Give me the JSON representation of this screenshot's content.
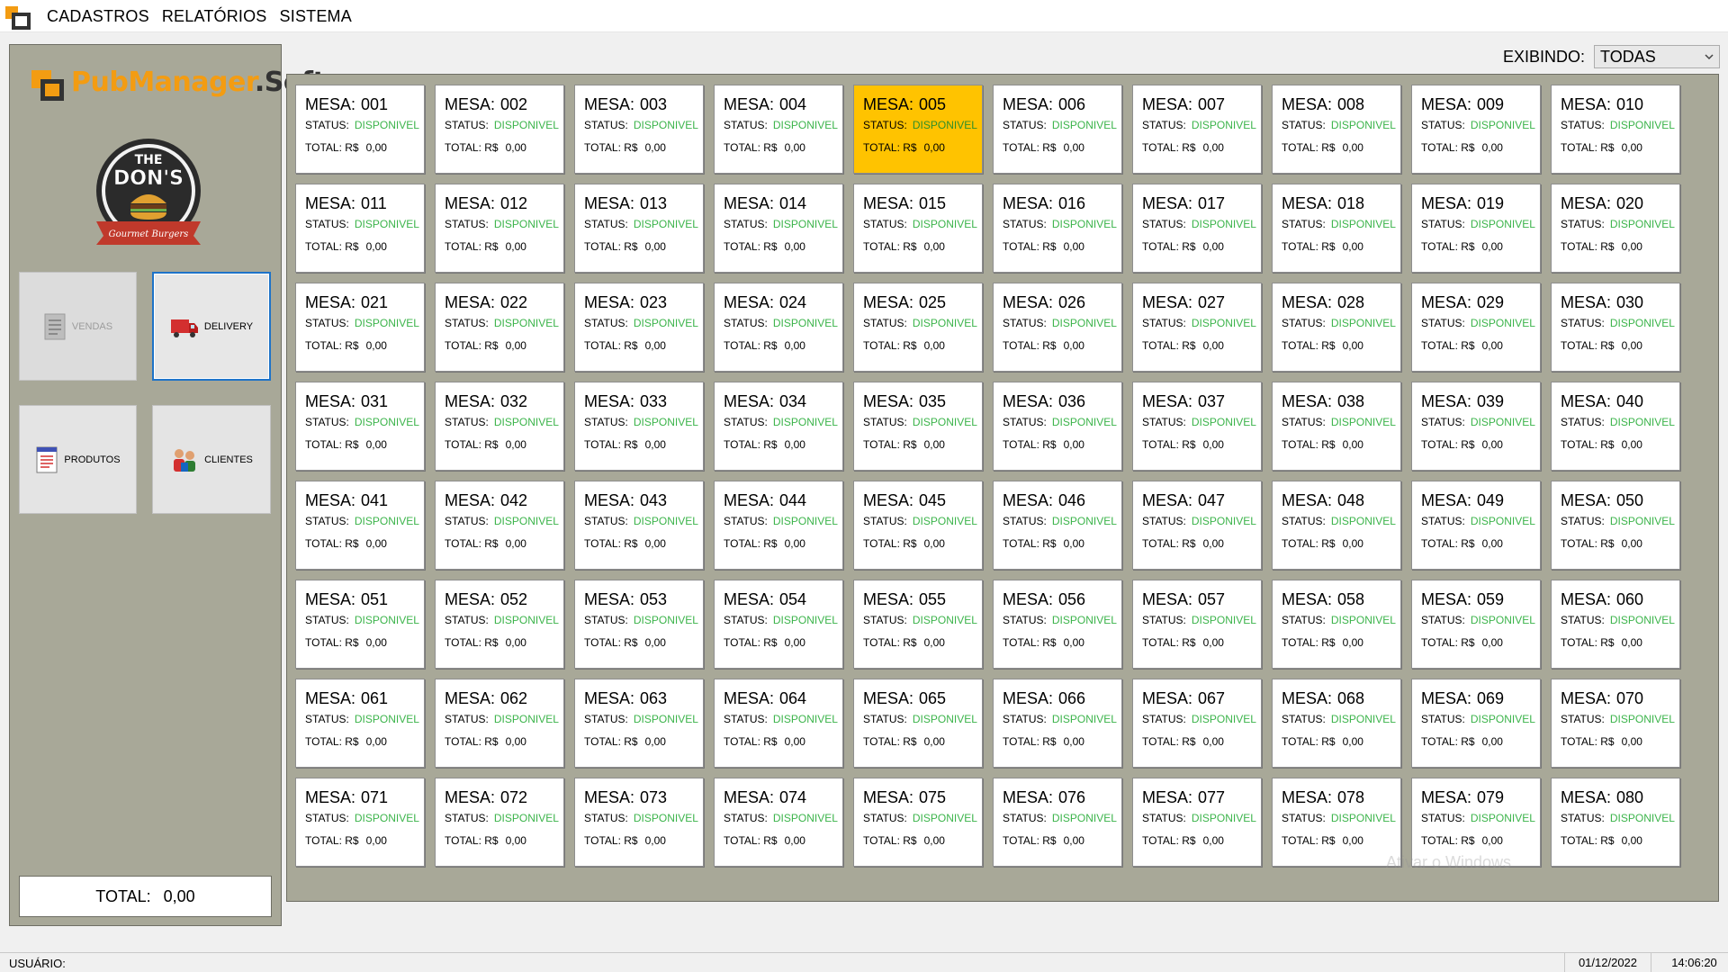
{
  "menu": {
    "items": [
      "CADASTROS",
      "RELATÓRIOS",
      "SISTEMA"
    ]
  },
  "brand": {
    "name_part1": "PubManager",
    "name_part2": ".Soft",
    "restaurant_logo_text": [
      "THE",
      "DON'S",
      "Gourmet Burgers"
    ]
  },
  "sidebar": {
    "buttons": [
      {
        "label": "VENDAS",
        "icon": "document-icon",
        "enabled": false
      },
      {
        "label": "DELIVERY",
        "icon": "delivery-truck-icon",
        "enabled": true,
        "selected": true
      },
      {
        "label": "PRODUTOS",
        "icon": "product-list-icon",
        "enabled": true
      },
      {
        "label": "CLIENTES",
        "icon": "customers-icon",
        "enabled": true
      }
    ],
    "total_label": "TOTAL:",
    "total_value": "0,00"
  },
  "filter": {
    "label": "EXIBINDO:",
    "selected": "TODAS"
  },
  "tables": {
    "title_label": "MESA:",
    "status_label": "STATUS:",
    "total_label": "TOTAL: R$",
    "status_value": "DISPONIVEL",
    "total_value": "0,00",
    "selected_number": "005",
    "numbers": [
      "001",
      "002",
      "003",
      "004",
      "005",
      "006",
      "007",
      "008",
      "009",
      "010",
      "011",
      "012",
      "013",
      "014",
      "015",
      "016",
      "017",
      "018",
      "019",
      "020",
      "021",
      "022",
      "023",
      "024",
      "025",
      "026",
      "027",
      "028",
      "029",
      "030",
      "031",
      "032",
      "033",
      "034",
      "035",
      "036",
      "037",
      "038",
      "039",
      "040",
      "041",
      "042",
      "043",
      "044",
      "045",
      "046",
      "047",
      "048",
      "049",
      "050",
      "051",
      "052",
      "053",
      "054",
      "055",
      "056",
      "057",
      "058",
      "059",
      "060",
      "061",
      "062",
      "063",
      "064",
      "065",
      "066",
      "067",
      "068",
      "069",
      "070",
      "071",
      "072",
      "073",
      "074",
      "075",
      "076",
      "077",
      "078",
      "079",
      "080"
    ]
  },
  "watermark": "Ativar o Windows",
  "statusbar": {
    "user_label": "USUÁRIO:",
    "date": "01/12/2022",
    "time": "14:06:20"
  },
  "colors": {
    "panel_bg": "#a8a898",
    "selected_table": "#ffc300",
    "status_available": "#3cb44b",
    "brand_orange": "#f39c12",
    "selected_button_border": "#1e73c8"
  }
}
